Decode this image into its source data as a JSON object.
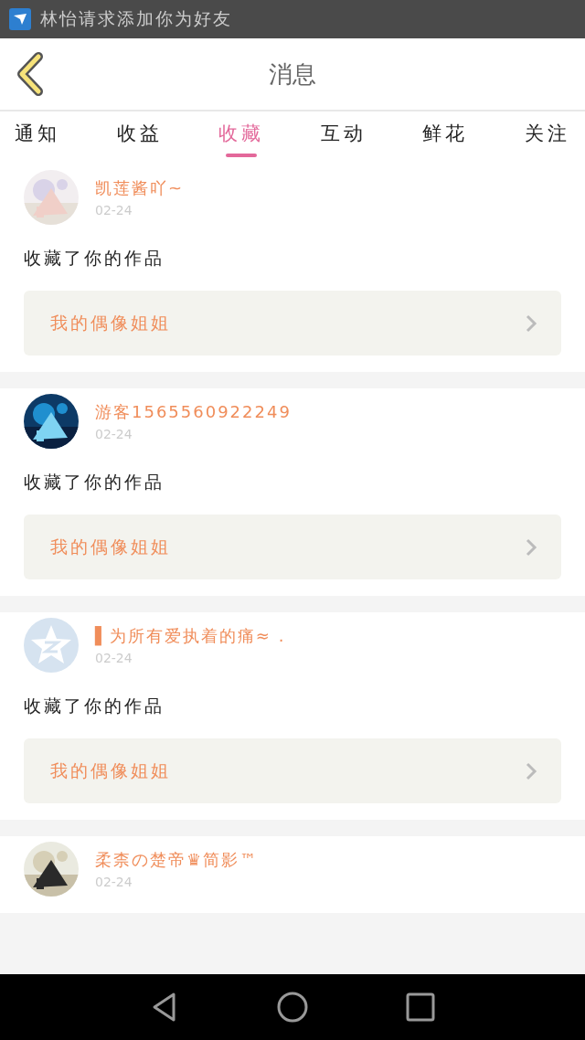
{
  "status_bar": {
    "notification": "林怡请求添加你为好友"
  },
  "header": {
    "title": "消息"
  },
  "tabs": [
    {
      "label": "通知",
      "selected": false
    },
    {
      "label": "收益",
      "selected": false
    },
    {
      "label": "收藏",
      "selected": true
    },
    {
      "label": "互动",
      "selected": false
    },
    {
      "label": "鲜花",
      "selected": false
    },
    {
      "label": "关注",
      "selected": false
    }
  ],
  "messages": [
    {
      "name": "凯莲酱吖~",
      "date": "02-24",
      "text": "收藏了你的作品",
      "work": "我的偶像姐姐"
    },
    {
      "name": "游客1565560922249",
      "date": "02-24",
      "text": "收藏了你的作品",
      "work": "我的偶像姐姐"
    },
    {
      "avatar": {
        "kind": "default"
      },
      "name": "▌为所有爱执着的痛≈ .",
      "date": "02-24",
      "text": "收藏了你的作品",
      "work": "我的偶像姐姐"
    },
    {
      "name": "柔柰の楚帝♛简影™",
      "date": "02-24"
    }
  ]
}
